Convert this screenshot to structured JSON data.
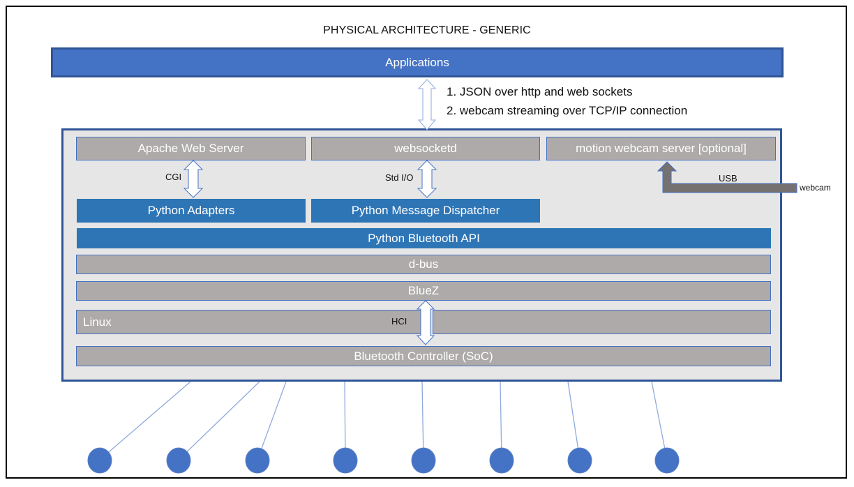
{
  "title": "PHYSICAL ARCHITECTURE - GENERIC",
  "applications": {
    "label": "Applications"
  },
  "connection_notes": [
    "1. JSON over http and web sockets",
    "2. webcam streaming over TCP/IP connection"
  ],
  "servers": {
    "apache": "Apache Web Server",
    "websocketd": "websocketd",
    "motion": "motion webcam server [optional]"
  },
  "interfaces": {
    "cgi": "CGI",
    "stdio": "Std I/O",
    "usb": "USB",
    "hci": "HCI"
  },
  "external": {
    "webcam": "webcam"
  },
  "python_layer": {
    "adapters": "Python Adapters",
    "dispatcher": "Python Message Dispatcher",
    "bluetooth_api": "Python Bluetooth API"
  },
  "stack": {
    "dbus": "d-bus",
    "bluez": "BlueZ",
    "linux": "Linux",
    "controller": "Bluetooth Controller (SoC)"
  },
  "devices": {
    "count": 8
  },
  "colors": {
    "applications_fill": "#4472c4",
    "applications_border": "#2f5597",
    "python_fill": "#2e75b6",
    "gray_fill": "#aeaaaa",
    "container_fill": "#e7e6e6",
    "device_fill": "#4472c4",
    "usb_arrow": "#767171"
  }
}
